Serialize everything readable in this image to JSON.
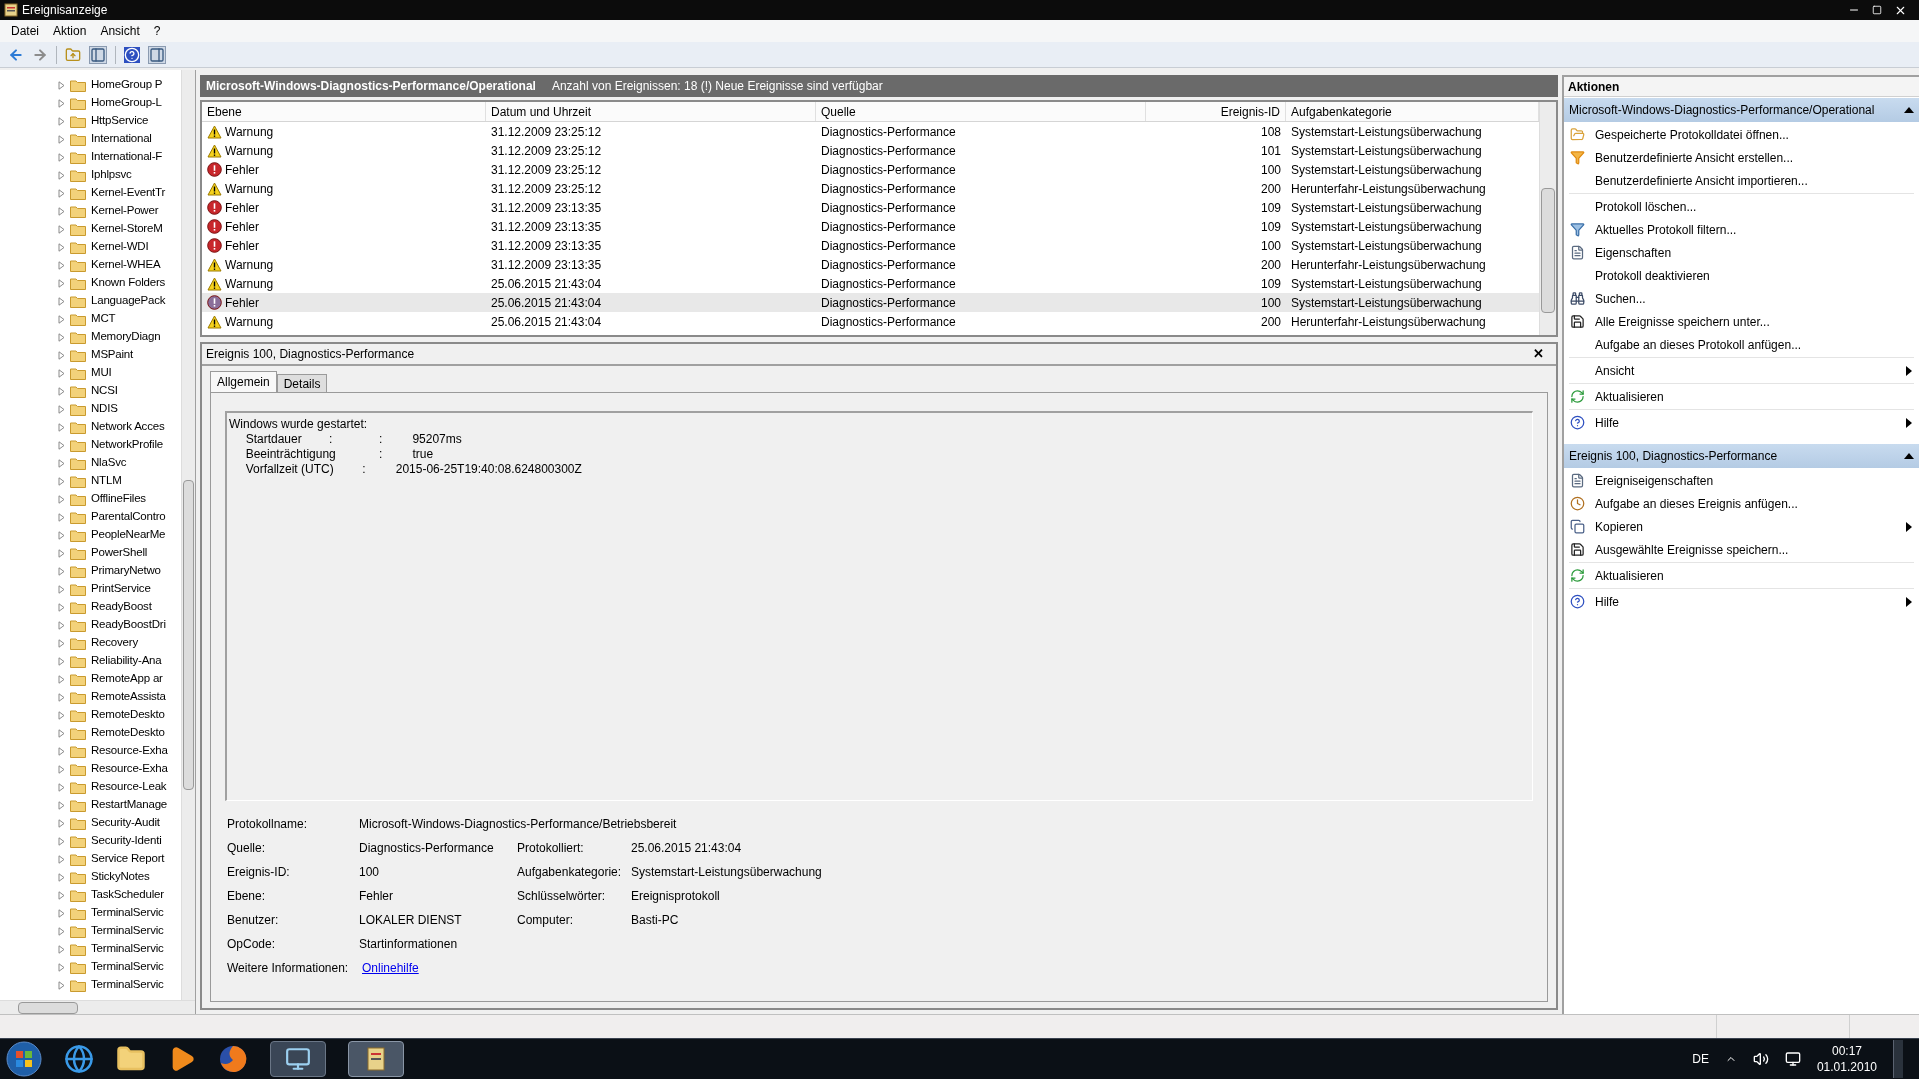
{
  "window": {
    "title": "Ereignisanzeige"
  },
  "menu": [
    "Datei",
    "Aktion",
    "Ansicht",
    "?"
  ],
  "tree": {
    "items": [
      "HomeGroup P",
      "HomeGroup-L",
      "HttpService",
      "International",
      "International-F",
      "Iphlpsvc",
      "Kernel-EventTr",
      "Kernel-Power",
      "Kernel-StoreM",
      "Kernel-WDI",
      "Kernel-WHEA",
      "Known Folders",
      "LanguagePack",
      "MCT",
      "MemoryDiagn",
      "MSPaint",
      "MUI",
      "NCSI",
      "NDIS",
      "Network Acces",
      "NetworkProfile",
      "NlaSvc",
      "NTLM",
      "OfflineFiles",
      "ParentalContro",
      "PeopleNearMe",
      "PowerShell",
      "PrimaryNetwo",
      "PrintService",
      "ReadyBoost",
      "ReadyBoostDri",
      "Recovery",
      "Reliability-Ana",
      "RemoteApp ar",
      "RemoteAssista",
      "RemoteDeskto",
      "RemoteDeskto",
      "Resource-Exha",
      "Resource-Exha",
      "Resource-Leak",
      "RestartManage",
      "Security-Audit",
      "Security-Identi",
      "Service Report",
      "StickyNotes",
      "TaskScheduler",
      "TerminalServic",
      "TerminalServic",
      "TerminalServic",
      "TerminalServic",
      "TerminalServic"
    ]
  },
  "log_header": {
    "title": "Microsoft-Windows-Diagnostics-Performance/Operational",
    "info": "Anzahl von Ereignissen: 18 (!) Neue Ereignisse sind verfügbar"
  },
  "table": {
    "columns": [
      "Ebene",
      "Datum und Uhrzeit",
      "Quelle",
      "Ereignis-ID",
      "Aufgabenkategorie"
    ],
    "rows": [
      {
        "kind": "warning",
        "level": "Warnung",
        "date": "31.12.2009 23:25:12",
        "source": "Diagnostics-Performance",
        "id": "108",
        "category": "Systemstart-Leistungsüberwachung",
        "selected": false
      },
      {
        "kind": "warning",
        "level": "Warnung",
        "date": "31.12.2009 23:25:12",
        "source": "Diagnostics-Performance",
        "id": "101",
        "category": "Systemstart-Leistungsüberwachung",
        "selected": false
      },
      {
        "kind": "error",
        "level": "Fehler",
        "date": "31.12.2009 23:25:12",
        "source": "Diagnostics-Performance",
        "id": "100",
        "category": "Systemstart-Leistungsüberwachung",
        "selected": false
      },
      {
        "kind": "warning",
        "level": "Warnung",
        "date": "31.12.2009 23:25:12",
        "source": "Diagnostics-Performance",
        "id": "200",
        "category": "Herunterfahr-Leistungsüberwachung",
        "selected": false
      },
      {
        "kind": "error",
        "level": "Fehler",
        "date": "31.12.2009 23:13:35",
        "source": "Diagnostics-Performance",
        "id": "109",
        "category": "Systemstart-Leistungsüberwachung",
        "selected": false
      },
      {
        "kind": "error",
        "level": "Fehler",
        "date": "31.12.2009 23:13:35",
        "source": "Diagnostics-Performance",
        "id": "109",
        "category": "Systemstart-Leistungsüberwachung",
        "selected": false
      },
      {
        "kind": "error",
        "level": "Fehler",
        "date": "31.12.2009 23:13:35",
        "source": "Diagnostics-Performance",
        "id": "100",
        "category": "Systemstart-Leistungsüberwachung",
        "selected": false
      },
      {
        "kind": "warning",
        "level": "Warnung",
        "date": "31.12.2009 23:13:35",
        "source": "Diagnostics-Performance",
        "id": "200",
        "category": "Herunterfahr-Leistungsüberwachung",
        "selected": false
      },
      {
        "kind": "warning",
        "level": "Warnung",
        "date": "25.06.2015 21:43:04",
        "source": "Diagnostics-Performance",
        "id": "109",
        "category": "Systemstart-Leistungsüberwachung",
        "selected": false
      },
      {
        "kind": "error",
        "level": "Fehler",
        "date": "25.06.2015 21:43:04",
        "source": "Diagnostics-Performance",
        "id": "100",
        "category": "Systemstart-Leistungsüberwachung",
        "selected": true
      },
      {
        "kind": "warning",
        "level": "Warnung",
        "date": "25.06.2015 21:43:04",
        "source": "Diagnostics-Performance",
        "id": "200",
        "category": "Herunterfahr-Leistungsüberwachung",
        "selected": false
      }
    ]
  },
  "detail": {
    "title": "Ereignis 100, Diagnostics-Performance",
    "close": "✕",
    "tabs": [
      {
        "label": "Allgemein",
        "selected": true
      },
      {
        "label": "Details",
        "selected": false
      }
    ],
    "message": [
      "Windows wurde gestartet:",
      "\tStartdauer\t\t:\t\t\t:\t\t95207ms",
      "\tBeeinträchtigung\t\t\t:\t\ttrue",
      "\tVorfallzeit (UTC)\t\t:\t\t2015-06-25T19:40:08.624800300Z"
    ],
    "log_name": {
      "label": "Protokollname:",
      "value": "Microsoft-Windows-Diagnostics-Performance/Betriebsbereit"
    },
    "fields": [
      {
        "label": "Quelle:",
        "value": "Diagnostics-Performance",
        "label2": "Protokolliert:",
        "value2": "25.06.2015 21:43:04"
      },
      {
        "label": "Ereignis-ID:",
        "value": "100",
        "label2": "Aufgabenkategorie:",
        "value2": "Systemstart-Leistungsüberwachung"
      },
      {
        "label": "Ebene:",
        "value": "Fehler",
        "label2": "Schlüsselwörter:",
        "value2": "Ereignisprotokoll"
      },
      {
        "label": "Benutzer:",
        "value": "LOKALER DIENST",
        "label2": "Computer:",
        "value2": "Basti-PC"
      },
      {
        "label": "OpCode:",
        "value": "Startinformationen"
      }
    ],
    "more_info": {
      "label": "Weitere Informationen:",
      "link": "Onlinehilfe"
    }
  },
  "actions": {
    "title": "Aktionen",
    "sections": [
      {
        "title": "Microsoft-Windows-Diagnostics-Performance/Operational",
        "expanded": true,
        "groups": [
          [
            {
              "kind": "open",
              "label": "Gespeicherte Protokolldatei öffnen...",
              "submenu": false
            },
            {
              "kind": "new-filter",
              "label": "Benutzerdefinierte Ansicht erstellen...",
              "submenu": false
            },
            {
              "kind": "none",
              "label": "Benutzerdefinierte Ansicht importieren...",
              "submenu": false
            }
          ],
          [
            {
              "kind": "none",
              "label": "Protokoll löschen...",
              "submenu": false
            },
            {
              "kind": "filter",
              "label": "Aktuelles Protokoll filtern...",
              "submenu": false
            },
            {
              "kind": "properties",
              "label": "Eigenschaften",
              "submenu": false
            },
            {
              "kind": "none",
              "label": "Protokoll deaktivieren",
              "submenu": false
            },
            {
              "kind": "find",
              "label": "Suchen...",
              "submenu": false
            },
            {
              "kind": "save",
              "label": "Alle Ereignisse speichern unter...",
              "submenu": false
            },
            {
              "kind": "none",
              "label": "Aufgabe an dieses Protokoll anfügen...",
              "submenu": false
            }
          ],
          [
            {
              "kind": "none",
              "label": "Ansicht",
              "submenu": true
            }
          ],
          [
            {
              "kind": "refresh",
              "label": "Aktualisieren",
              "submenu": false
            }
          ],
          [
            {
              "kind": "help",
              "label": "Hilfe",
              "submenu": true
            }
          ]
        ]
      },
      {
        "title": "Ereignis 100, Diagnostics-Performance",
        "expanded": true,
        "groups": [
          [
            {
              "kind": "properties",
              "label": "Ereigniseigenschaften",
              "submenu": false
            },
            {
              "kind": "task",
              "label": "Aufgabe an dieses Ereignis anfügen...",
              "submenu": false
            },
            {
              "kind": "copy",
              "label": "Kopieren",
              "submenu": true
            },
            {
              "kind": "save",
              "label": "Ausgewählte Ereignisse speichern...",
              "submenu": false
            }
          ],
          [
            {
              "kind": "refresh",
              "label": "Aktualisieren",
              "submenu": false
            }
          ],
          [
            {
              "kind": "help",
              "label": "Hilfe",
              "submenu": true
            }
          ]
        ]
      }
    ]
  },
  "taskbar": {
    "language": "DE",
    "time": "00:17",
    "date": "01.01.2010"
  }
}
